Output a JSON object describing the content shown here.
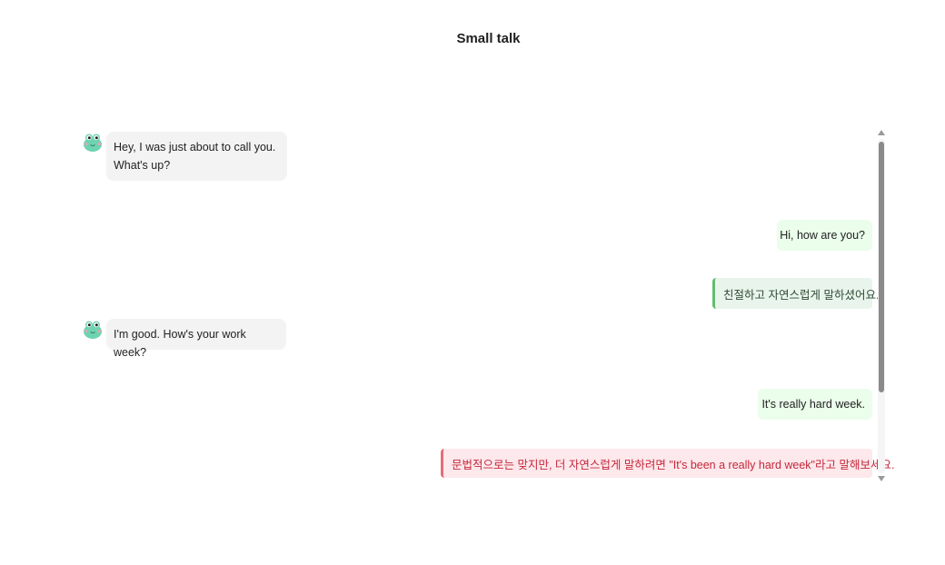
{
  "header": {
    "title": "Small talk"
  },
  "messages": [
    {
      "role": "bot",
      "avatar_icon": "frog-avatar-icon",
      "lines": [
        "Hey, I was just about to call you.",
        "What's up?"
      ]
    },
    {
      "role": "user",
      "text": "Hi, how are you?"
    },
    {
      "role": "feedback",
      "status": "good",
      "text": "친절하고 자연스럽게 말하셨어요."
    },
    {
      "role": "bot",
      "avatar_icon": "frog-avatar-icon",
      "lines": [
        "I'm good. How's your work week?"
      ]
    },
    {
      "role": "user",
      "text": "It's really hard week."
    },
    {
      "role": "feedback",
      "status": "bad",
      "text": "문법적으로는 맞지만, 더 자연스럽게 말하려면 \"It's been a really hard week\"라고 말해보세요."
    }
  ],
  "colors": {
    "bot_bubble": "#f3f3f3",
    "user_bubble": "#ebfdeb",
    "feedback_good_bg": "#e9f5ec",
    "feedback_good_border": "#62bd6f",
    "feedback_bad_bg": "#fde8ec",
    "feedback_bad_border": "#e46c78",
    "feedback_bad_text": "#c4283a"
  }
}
